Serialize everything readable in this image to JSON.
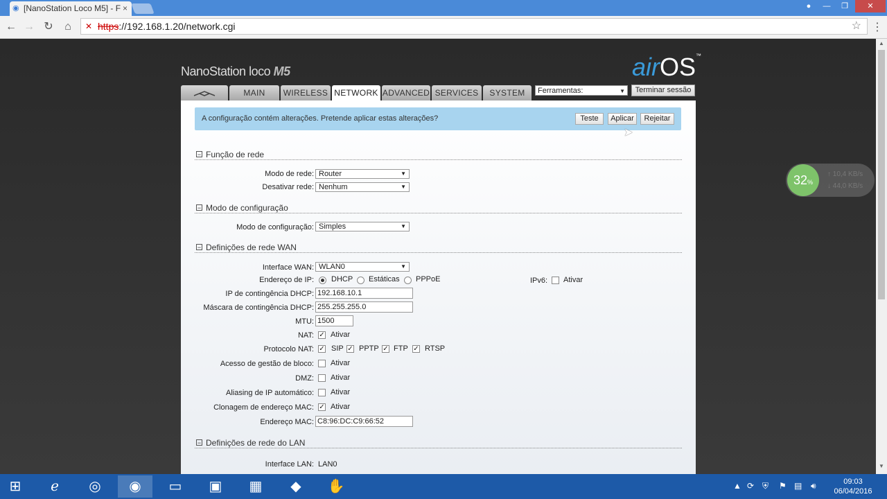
{
  "browser": {
    "tab_title": "[NanoStation Loco M5] - F",
    "tab_close": "×",
    "url_protocol": "https",
    "url_rest": "://192.168.1.20/network.cgi"
  },
  "brand": {
    "name": "NanoStation loco",
    "model": "M5",
    "logo_air": "air",
    "logo_os": "OS",
    "logo_tm": "™"
  },
  "nav": {
    "tabs": [
      "MAIN",
      "WIRELESS",
      "NETWORK",
      "ADVANCED",
      "SERVICES",
      "SYSTEM"
    ],
    "active": "NETWORK",
    "tools_select": "Ferramentas:",
    "logout": "Terminar sessão"
  },
  "alert": {
    "message": "A configuração contém alterações. Pretende aplicar estas alterações?",
    "buttons": [
      "Teste",
      "Aplicar",
      "Rejeitar"
    ]
  },
  "sections": {
    "network_role": {
      "title": "Função de rede",
      "mode_label": "Modo de rede:",
      "mode_value": "Router",
      "disable_label": "Desativar rede:",
      "disable_value": "Nenhum"
    },
    "config_mode": {
      "title": "Modo de configuração",
      "label": "Modo de configuração:",
      "value": "Simples"
    },
    "wan": {
      "title": "Definições de rede WAN",
      "interface_label": "Interface WAN:",
      "interface_value": "WLAN0",
      "ip_label": "Endereço de IP:",
      "ip_options": [
        "DHCP",
        "Estáticas",
        "PPPoE"
      ],
      "ip_selected": "DHCP",
      "ipv6_label": "IPv6:",
      "ipv6_option": "Ativar",
      "dhcp_fallback_ip_label": "IP de contingência DHCP:",
      "dhcp_fallback_ip": "192.168.10.1",
      "dhcp_fallback_mask_label": "Máscara de contingência DHCP:",
      "dhcp_fallback_mask": "255.255.255.0",
      "mtu_label": "MTU:",
      "mtu": "1500",
      "nat_label": "NAT:",
      "nat_option": "Ativar",
      "nat_protocol_label": "Protocolo NAT:",
      "nat_protocols": [
        "SIP",
        "PPTP",
        "FTP",
        "RTSP"
      ],
      "block_mgmt_label": "Acesso de gestão de bloco:",
      "block_mgmt_option": "Ativar",
      "dmz_label": "DMZ:",
      "dmz_option": "Ativar",
      "auto_ip_alias_label": "Aliasing de IP automático:",
      "auto_ip_alias_option": "Ativar",
      "mac_clone_label": "Clonagem de endereço MAC:",
      "mac_clone_option": "Ativar",
      "mac_label": "Endereço MAC:",
      "mac_value": "C8:96:DC:C9:66:52"
    },
    "lan": {
      "title": "Definições de rede do LAN",
      "interface_label": "Interface LAN:",
      "interface_value": "LAN0"
    }
  },
  "speed_widget": {
    "percent": "32",
    "percent_sign": "%",
    "up": "10,4 KB/s",
    "down": "44,0 KB/s"
  },
  "clock": {
    "time": "09:03",
    "date": "06/04/2016"
  }
}
